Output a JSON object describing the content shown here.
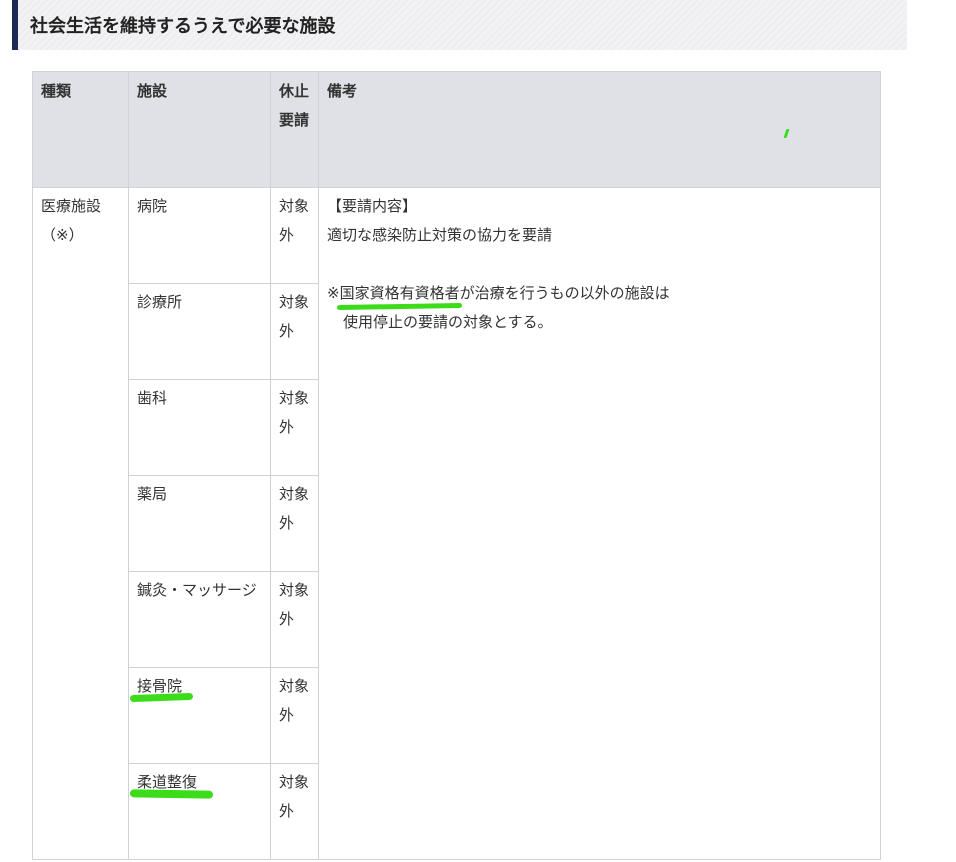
{
  "heading": "社会生活を維持するうえで必要な施設",
  "table": {
    "headers": {
      "type": "種類",
      "facility": "施設",
      "closure_request": "休止要請",
      "remarks": "備考"
    },
    "category": {
      "name": "医療施設",
      "note": "（※）"
    },
    "rows": [
      {
        "facility": "病院",
        "status": "対象外"
      },
      {
        "facility": "診療所",
        "status": "対象外"
      },
      {
        "facility": "歯科",
        "status": "対象外"
      },
      {
        "facility": "薬局",
        "status": "対象外"
      },
      {
        "facility": "鍼灸・マッサージ",
        "status": "対象外"
      },
      {
        "facility": "接骨院",
        "status": "対象外"
      },
      {
        "facility": "柔道整復",
        "status": "対象外"
      }
    ],
    "remarks": {
      "request_label": "【要請内容】",
      "request_text": "適切な感染防止対策の協力を要請",
      "footnote_mark": "※",
      "footnote_highlight": "国家資格有資格者",
      "footnote_rest": "が治療を行うもの以外の施設は",
      "footnote_line2": "使用停止の要請の対象とする。"
    }
  },
  "colors": {
    "heading_bar": "#1b2a57",
    "header_bg": "#dfe1e6",
    "highlight_marker": "#3ddc1a"
  }
}
